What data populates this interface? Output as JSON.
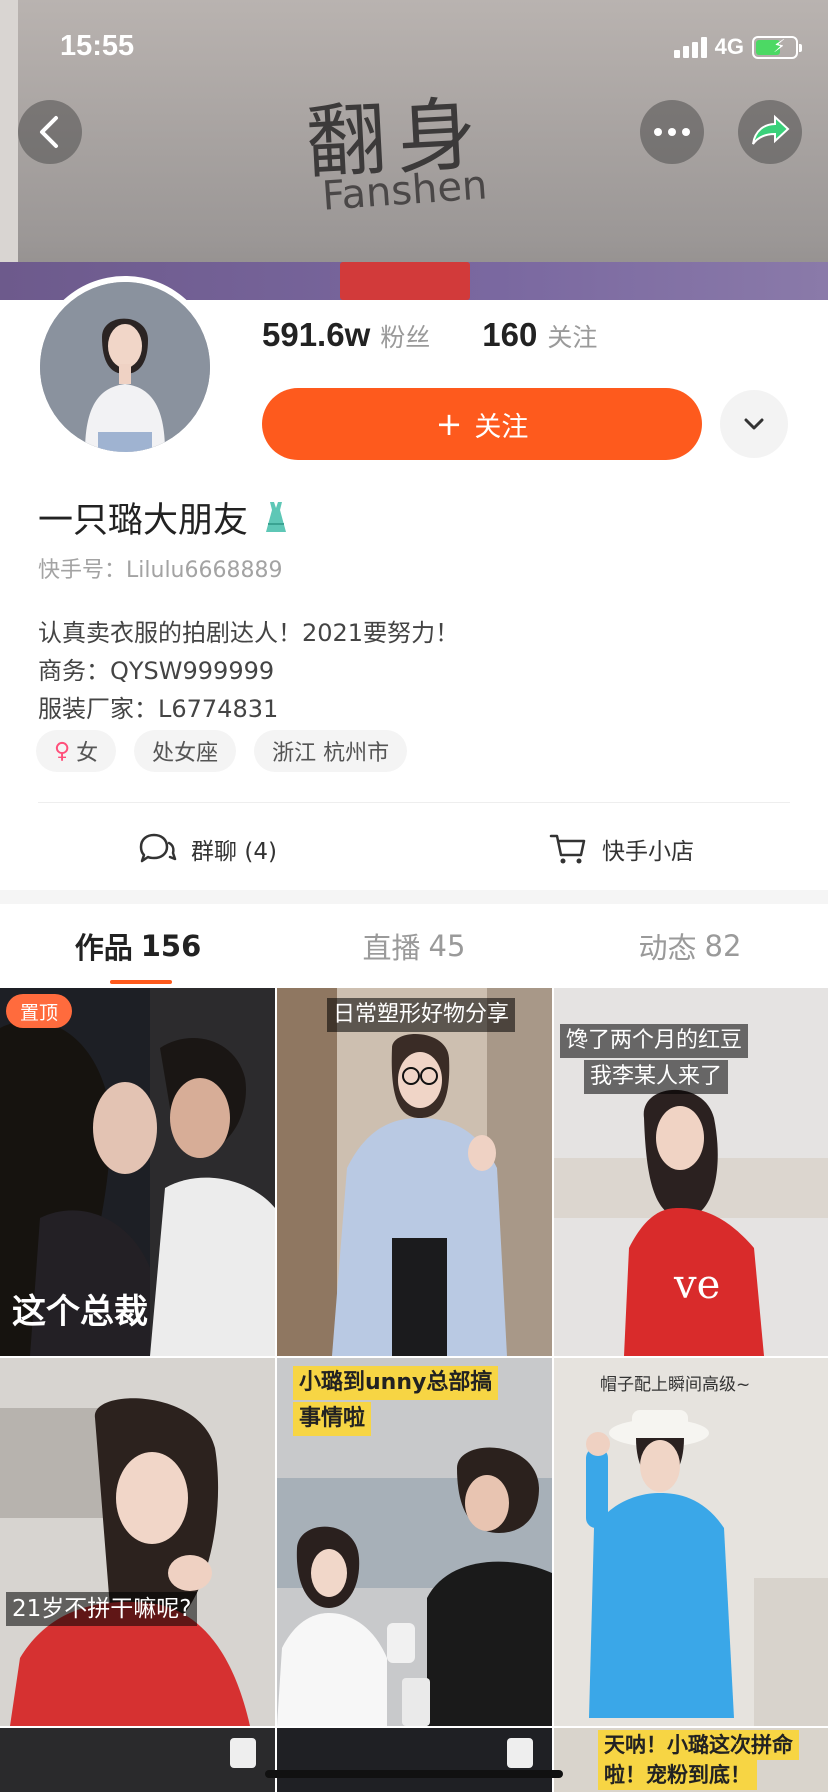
{
  "status_bar": {
    "time": "15:55",
    "network": "4G"
  },
  "cover": {
    "sign_cn": "翻身",
    "sign_en": "Fanshen"
  },
  "profile": {
    "followers_value": "591.6w",
    "followers_label": "粉丝",
    "following_value": "160",
    "following_label": "关注",
    "follow_button_label": "关注",
    "nickname": "一只璐大朋友",
    "id_label": "快手号：",
    "id_value": "Lilulu6668889",
    "bio_lines": [
      "认真卖衣服的拍剧达人！2021要努力！",
      "商务：QYSW999999",
      "服装厂家：L6774831"
    ],
    "tags": [
      "女",
      "处女座",
      "浙江 杭州市"
    ],
    "actions": [
      {
        "label": "群聊 (4)",
        "icon": "chat-bubbles-icon"
      },
      {
        "label": "快手小店",
        "icon": "shopping-cart-icon"
      }
    ]
  },
  "tabs": [
    {
      "label": "作品",
      "count": "156",
      "active": true
    },
    {
      "label": "直播",
      "count": "45",
      "active": false
    },
    {
      "label": "动态",
      "count": "82",
      "active": false
    }
  ],
  "grid": {
    "pinned_badge": "置顶",
    "captions": [
      "这个总裁",
      "日常塑形好物分享",
      "馋了两个月的红豆",
      "我李某人来了",
      "21岁不拼干嘛呢?",
      "小璐到unny总部搞",
      "事情啦",
      "帽子配上瞬间高级~",
      "天呐！小璐这次拼命",
      "啦！宠粉到底！"
    ]
  },
  "colors": {
    "accent": "#fe5a1d",
    "text_primary": "#222222",
    "text_secondary": "#9a9a9a"
  }
}
